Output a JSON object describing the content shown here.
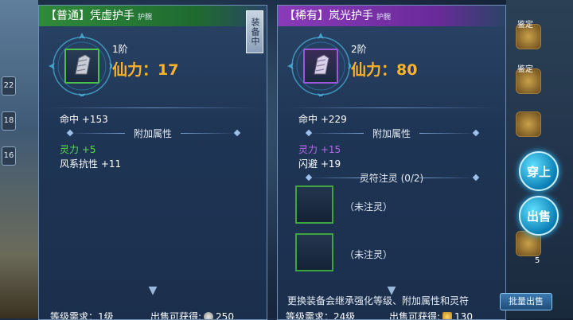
{
  "colors": {
    "accent_power": "#ffb32a",
    "common_green": "#4cc24c",
    "rare_purple": "#9a5ad8"
  },
  "left_panel": {
    "title": "【普通】凭虚护手",
    "subtitle": "护腕",
    "equipped_tag": "装备中",
    "level": "1阶",
    "power": "仙力：17",
    "main_stat": "命中 +153",
    "extra_attr_title": "附加属性",
    "extra_attrs": [
      "灵力 +5",
      "风系抗性 +11"
    ],
    "footer_req": "等级需求：1级",
    "footer_sell": "出售可获得:",
    "sell_value": "250"
  },
  "right_panel": {
    "title": "【稀有】岚光护手",
    "subtitle": "护腕",
    "level": "2阶",
    "power": "仙力：80",
    "main_stat": "命中 +229",
    "extra_attr_title": "附加属性",
    "extra_attrs": [
      "灵力 +15",
      "闪避 +19"
    ],
    "rune_title": "灵符注灵 (0/2)",
    "rune_slots": [
      "（未注灵）",
      "（未注灵）"
    ],
    "hint": "更换装备会继承强化等级、附加属性和灵符",
    "footer_req": "等级需求：24级",
    "footer_sell": "出售可获得:",
    "sell_value": "130"
  },
  "side_buttons": {
    "equip": "穿上",
    "sell": "出售",
    "bulk": "批量出售"
  },
  "left_strip": {
    "slot_labels": [
      "22",
      "18",
      "16"
    ]
  },
  "right_strip": {
    "labels": [
      "鉴定",
      "鉴定",
      "5"
    ]
  }
}
